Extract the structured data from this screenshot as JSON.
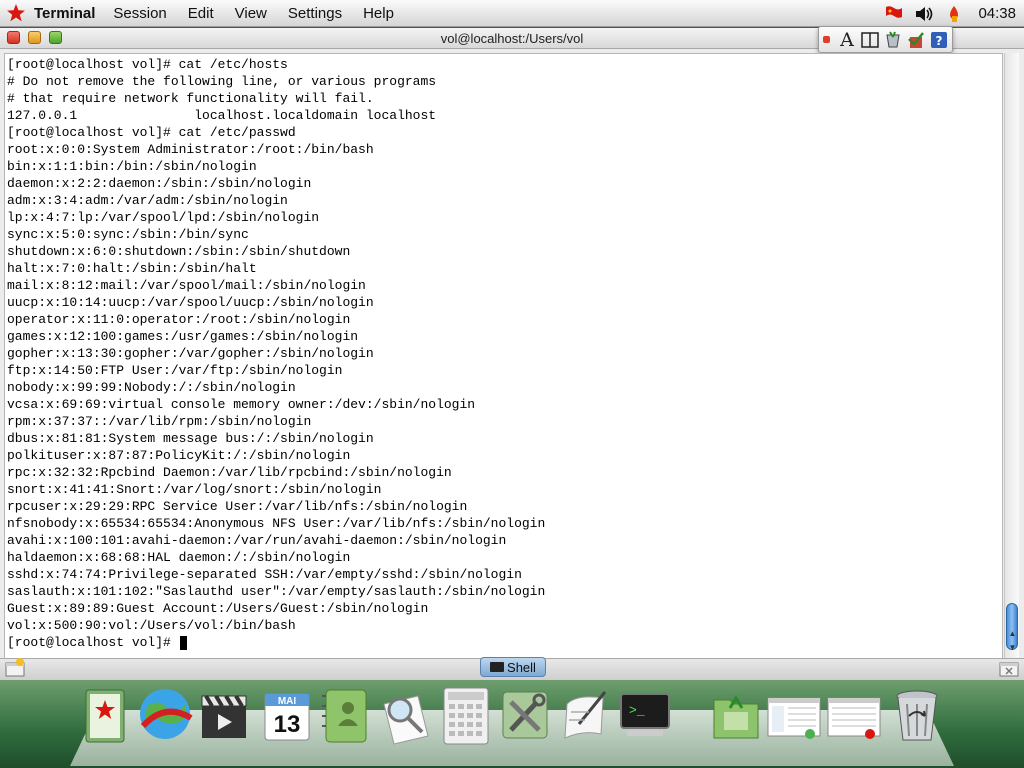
{
  "menubar": {
    "app_name": "Terminal",
    "menus": [
      "Session",
      "Edit",
      "View",
      "Settings",
      "Help"
    ],
    "clock": "04:38",
    "icons": [
      "red-star-logo-icon",
      "flag-icon",
      "speaker-icon",
      "battery-icon"
    ]
  },
  "window": {
    "title": "vol@localhost:/Users/vol",
    "palette_icons": [
      "palette-close-icon",
      "font-icon",
      "columns-icon",
      "cup-icon",
      "checklist-icon",
      "help-icon"
    ],
    "palette_font_glyph": "A"
  },
  "terminal": {
    "lines": [
      "[root@localhost vol]# cat /etc/hosts",
      "# Do not remove the following line, or various programs",
      "# that require network functionality will fail.",
      "127.0.0.1               localhost.localdomain localhost",
      "[root@localhost vol]# cat /etc/passwd",
      "root:x:0:0:System Administrator:/root:/bin/bash",
      "bin:x:1:1:bin:/bin:/sbin/nologin",
      "daemon:x:2:2:daemon:/sbin:/sbin/nologin",
      "adm:x:3:4:adm:/var/adm:/sbin/nologin",
      "lp:x:4:7:lp:/var/spool/lpd:/sbin/nologin",
      "sync:x:5:0:sync:/sbin:/bin/sync",
      "shutdown:x:6:0:shutdown:/sbin:/sbin/shutdown",
      "halt:x:7:0:halt:/sbin:/sbin/halt",
      "mail:x:8:12:mail:/var/spool/mail:/sbin/nologin",
      "uucp:x:10:14:uucp:/var/spool/uucp:/sbin/nologin",
      "operator:x:11:0:operator:/root:/sbin/nologin",
      "games:x:12:100:games:/usr/games:/sbin/nologin",
      "gopher:x:13:30:gopher:/var/gopher:/sbin/nologin",
      "ftp:x:14:50:FTP User:/var/ftp:/sbin/nologin",
      "nobody:x:99:99:Nobody:/:/sbin/nologin",
      "vcsa:x:69:69:virtual console memory owner:/dev:/sbin/nologin",
      "rpm:x:37:37::/var/lib/rpm:/sbin/nologin",
      "dbus:x:81:81:System message bus:/:/sbin/nologin",
      "polkituser:x:87:87:PolicyKit:/:/sbin/nologin",
      "rpc:x:32:32:Rpcbind Daemon:/var/lib/rpcbind:/sbin/nologin",
      "snort:x:41:41:Snort:/var/log/snort:/sbin/nologin",
      "rpcuser:x:29:29:RPC Service User:/var/lib/nfs:/sbin/nologin",
      "nfsnobody:x:65534:65534:Anonymous NFS User:/var/lib/nfs:/sbin/nologin",
      "avahi:x:100:101:avahi-daemon:/var/run/avahi-daemon:/sbin/nologin",
      "haldaemon:x:68:68:HAL daemon:/:/sbin/nologin",
      "sshd:x:74:74:Privilege-separated SSH:/var/empty/sshd:/sbin/nologin",
      "saslauth:x:101:102:\"Saslauthd user\":/var/empty/saslauth:/sbin/nologin",
      "Guest:x:89:89:Guest Account:/Users/Guest:/sbin/nologin",
      "vol:x:500:90:vol:/Users/vol:/bin/bash",
      "[root@localhost vol]# "
    ]
  },
  "tabbar": {
    "shell_tab": "Shell",
    "icons": [
      "new-tab-icon",
      "terminal-tab-icon",
      "close-tab-icon"
    ]
  },
  "dock": {
    "calendar_month": "MAI",
    "calendar_day": "13",
    "terminal_prompt": ">_",
    "items": [
      "address-book-icon",
      "browser-globe-icon",
      "video-clapper-icon",
      "calendar-icon",
      "contacts-icon",
      "document-viewer-icon",
      "calculator-icon",
      "system-tools-icon",
      "text-editor-icon",
      "terminal-icon",
      "file-manager-icon",
      "window-thumbnail-icon",
      "window-thumbnail-icon",
      "trash-icon"
    ]
  },
  "colors": {
    "desktop": "#2d6b3a",
    "terminal_bg": "#ffffff",
    "terminal_fg": "#000000",
    "scroll_thumb": "#4a8fd8"
  }
}
